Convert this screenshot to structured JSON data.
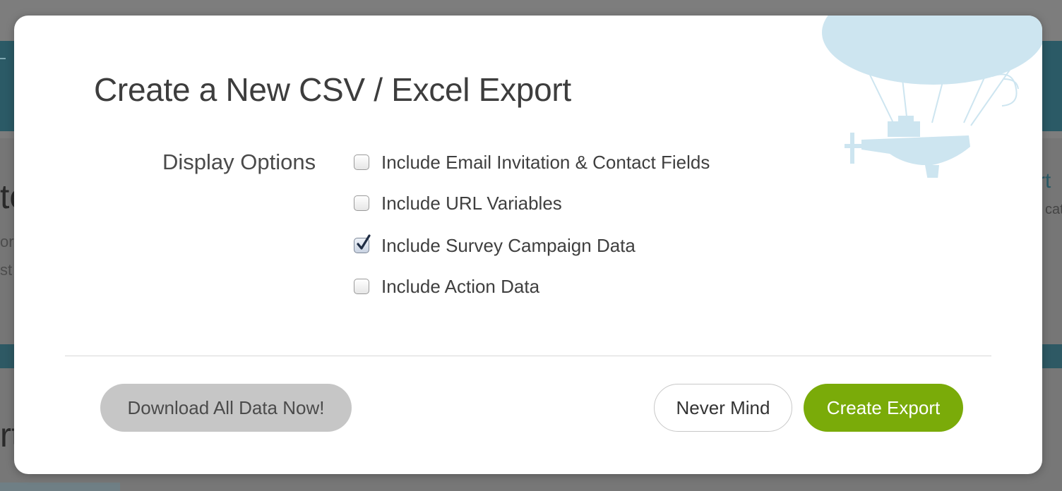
{
  "modal": {
    "title": "Create a New CSV / Excel Export",
    "display_options_label": "Display Options",
    "options": [
      {
        "label": "Include Email Invitation & Contact Fields",
        "checked": false
      },
      {
        "label": "Include URL Variables",
        "checked": false
      },
      {
        "label": "Include Survey Campaign Data",
        "checked": true
      },
      {
        "label": "Include Action Data",
        "checked": false
      }
    ],
    "buttons": {
      "download_all": "Download All Data Now!",
      "never_mind": "Never Mind",
      "create_export": "Create Export"
    }
  },
  "background": {
    "left_heading_1": "te",
    "left_text_1": "ort",
    "left_text_2": "st",
    "left_heading_2": "rt",
    "right_heading": "rt",
    "right_text": "cati"
  },
  "colors": {
    "primary_green": "#7aab09",
    "secondary_gray": "#c6c6c6",
    "header_teal": "#2b5a66",
    "balloon_blue": "#cde5f0"
  },
  "icons": {
    "balloon": "hot-air-balloon-illustration",
    "check": "checkmark-icon"
  }
}
